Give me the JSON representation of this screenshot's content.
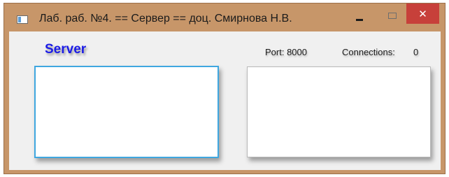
{
  "window": {
    "title": "Лаб. раб. №4. == Сервер == доц. Смирнова Н.В.",
    "icon": "app-window-icon",
    "controls": {
      "minimize_glyph": "–",
      "maximize_glyph": "□",
      "close_glyph": "✕",
      "close_color": "#c7403a"
    },
    "frame_color": "#c79669"
  },
  "main": {
    "server_label": "Server",
    "server_label_color": "#1b1be6",
    "port_label": "Port: 8000",
    "connections_label": "Connections:",
    "connections_count": "0"
  }
}
